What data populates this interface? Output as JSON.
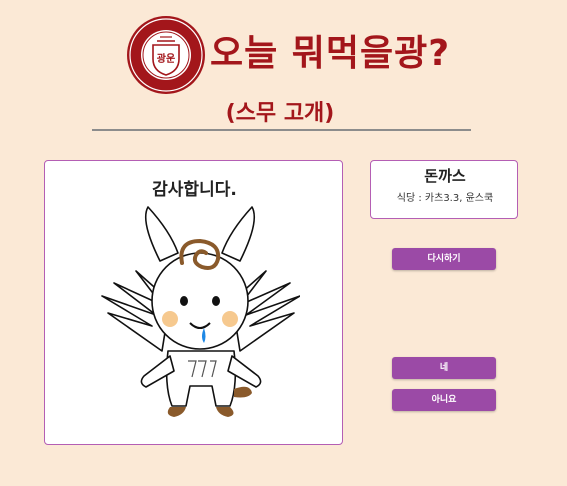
{
  "header": {
    "title": "오늘 뭐먹을광?",
    "subtitle": "(스무 고개)",
    "logo": {
      "center_text": "광운",
      "ring_text": "KWANGWOON UNIVERSITY · MAY 1934 · SEOUL KOREA",
      "top_text": "광운대학교",
      "color": "#a3161b"
    }
  },
  "main_image": {
    "caption": "감사합니다."
  },
  "result": {
    "name": "돈까스",
    "detail": "식당 : 카츠3.3, 윤스쿡"
  },
  "buttons": {
    "retry": "다시하기",
    "yes": "네",
    "no": "아니요"
  },
  "colors": {
    "background": "#fbe9d6",
    "accent": "#a3161b",
    "button": "#9b4aa6",
    "card_border": "#b45eb4"
  }
}
